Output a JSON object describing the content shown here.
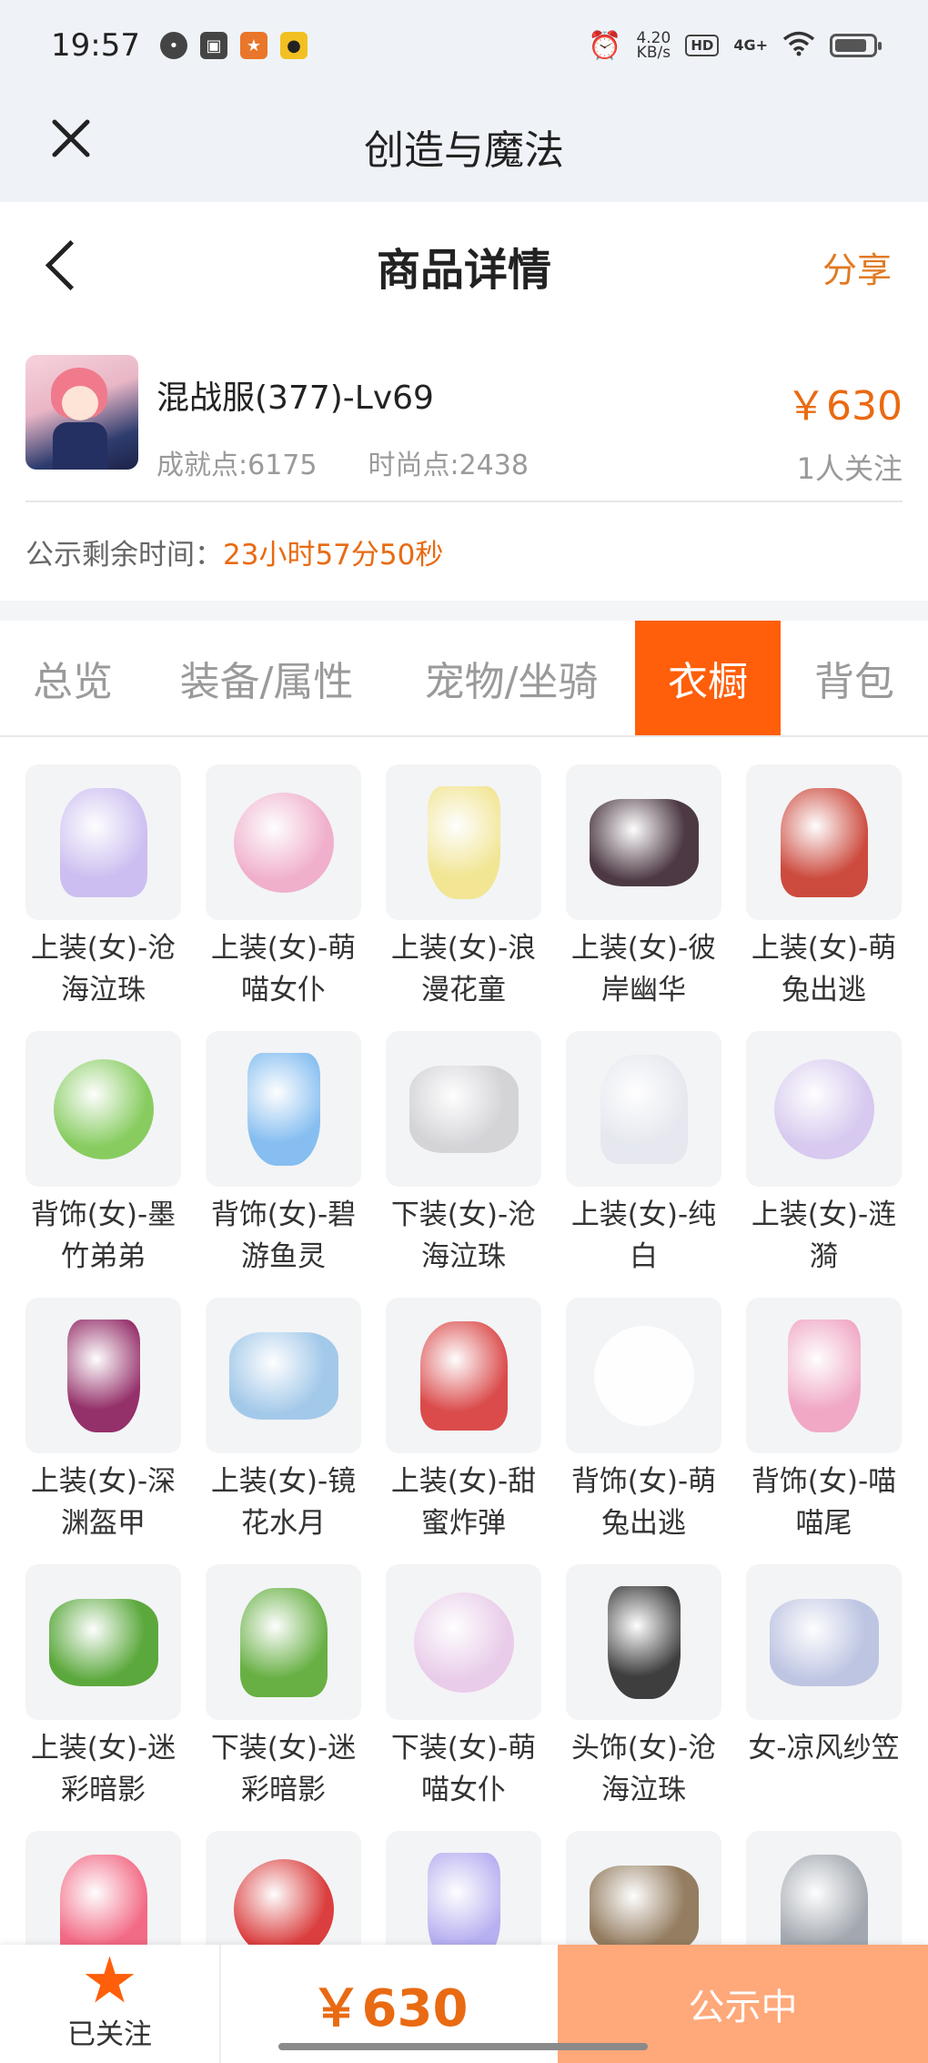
{
  "status_bar": {
    "time": "19:57",
    "net_speed_value": "4.20",
    "net_speed_unit": "KB/s",
    "hd": "HD",
    "signal": "4G+"
  },
  "app": {
    "title": "创造与魔法"
  },
  "detail": {
    "title": "商品详情",
    "share": "分享"
  },
  "product": {
    "server": "混战服(377)-Lv69",
    "achievement": "成就点:6175",
    "fashion": "时尚点:2438",
    "price": "￥630",
    "watchers": "1人关注",
    "countdown_label": "公示剩余时间：",
    "countdown_value": "23小时57分50秒"
  },
  "tabs": [
    {
      "label": "总览",
      "active": false
    },
    {
      "label": "装备/属性",
      "active": false
    },
    {
      "label": "宠物/坐骑",
      "active": false
    },
    {
      "label": "衣橱",
      "active": true
    },
    {
      "label": "背包",
      "active": false
    }
  ],
  "items": [
    {
      "label": "上装(女)-沧海泣珠",
      "icon": "lilac-dress-icon",
      "color": "#c8b8f0"
    },
    {
      "label": "上装(女)-萌喵女仆",
      "icon": "maid-dress-icon",
      "color": "#f0a8c8"
    },
    {
      "label": "上装(女)-浪漫花童",
      "icon": "flower-dress-icon",
      "color": "#f2e48a"
    },
    {
      "label": "上装(女)-彼岸幽华",
      "icon": "dark-kimono-icon",
      "color": "#3a2430"
    },
    {
      "label": "上装(女)-萌兔出逃",
      "icon": "red-outfit-icon",
      "color": "#c8382a"
    },
    {
      "label": "背饰(女)-墨竹弟弟",
      "icon": "panda-backpack-icon",
      "color": "#7cc850"
    },
    {
      "label": "背饰(女)-碧游鱼灵",
      "icon": "water-wings-icon",
      "color": "#7ab8f0"
    },
    {
      "label": "下装(女)-沧海泣珠",
      "icon": "heels-legs-icon",
      "color": "#d0d0d4"
    },
    {
      "label": "上装(女)-纯白",
      "icon": "white-gown-icon",
      "color": "#e4e6ee"
    },
    {
      "label": "上装(女)-涟漪",
      "icon": "lavender-dress-icon",
      "color": "#d4c4ee"
    },
    {
      "label": "上装(女)-深渊盔甲",
      "icon": "abyss-armor-icon",
      "color": "#8a1a5a"
    },
    {
      "label": "上装(女)-镜花水月",
      "icon": "mirror-robe-icon",
      "color": "#9ac4e8"
    },
    {
      "label": "上装(女)-甜蜜炸弹",
      "icon": "sweet-dress-icon",
      "color": "#d83838"
    },
    {
      "label": "背饰(女)-萌兔出逃",
      "icon": "white-fluff-icon",
      "color": "#ffffff"
    },
    {
      "label": "背饰(女)-喵喵尾",
      "icon": "pink-tail-icon",
      "color": "#f0a0c0"
    },
    {
      "label": "上装(女)-迷彩暗影",
      "icon": "ghillie-top-icon",
      "color": "#4aa028"
    },
    {
      "label": "下装(女)-迷彩暗影",
      "icon": "ghillie-pants-icon",
      "color": "#58a830"
    },
    {
      "label": "下装(女)-萌喵女仆",
      "icon": "maid-legs-icon",
      "color": "#e8c8e8"
    },
    {
      "label": "头饰(女)-沧海泣珠",
      "icon": "pearl-headpiece-icon",
      "color": "#2a2a2a"
    },
    {
      "label": "女-凉风纱笠",
      "icon": "veil-hat-icon",
      "color": "#b8c0e0"
    },
    {
      "label": "",
      "icon": "pink-fox-mask-icon",
      "color": "#f25a78"
    },
    {
      "label": "",
      "icon": "red-gown-icon",
      "color": "#d82a2a"
    },
    {
      "label": "",
      "icon": "pastel-hair-icon",
      "color": "#b0a8f0"
    },
    {
      "label": "",
      "icon": "wide-hat-icon",
      "color": "#8a7050"
    },
    {
      "label": "",
      "icon": "silver-top-icon",
      "color": "#9aa0a8"
    }
  ],
  "bottom_bar": {
    "follow_label": "已关注",
    "price": "￥630",
    "status": "公示中"
  },
  "colors": {
    "accent": "#ff5e0a",
    "price": "#e96a12",
    "status_button": "#ffa87a"
  }
}
